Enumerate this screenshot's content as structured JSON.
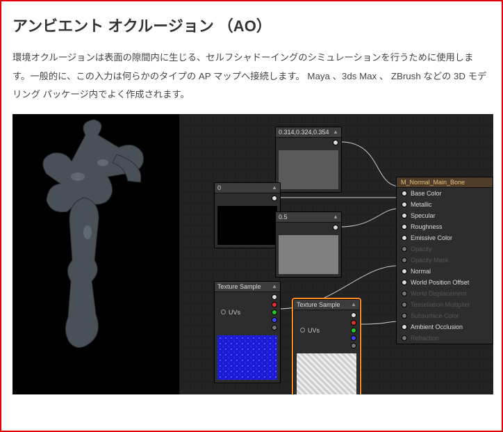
{
  "heading": "アンビエント オクルージョン （AO）",
  "paragraph": "環境オクルージョンは表面の隙間内に生じる、セルフシャドーイングのシミュレーションを行うために使用します。一般的に、この入力は何らかのタイプの AP マップへ接続します。 Maya 、3ds Max 、 ZBrush などの 3D モデリング パッケージ内でよく作成されます。",
  "nodes": {
    "c1": {
      "label": "0.314,0.324,0.354",
      "bg": "#5a5a5a"
    },
    "c2": {
      "label": "0",
      "bg": "#000000"
    },
    "c3": {
      "label": "0.5",
      "bg": "#808080"
    },
    "t1": {
      "label": "Texture Sample",
      "uvs": "UVs",
      "bg": "#1b1bd6"
    },
    "t2": {
      "label": "Texture Sample",
      "uvs": "UVs",
      "bg": "#d8d8d8"
    }
  },
  "material": {
    "title": "M_Normal_Main_Bone",
    "pins": [
      {
        "label": "Base Color",
        "active": true
      },
      {
        "label": "Metallic",
        "active": true
      },
      {
        "label": "Specular",
        "active": true
      },
      {
        "label": "Roughness",
        "active": true
      },
      {
        "label": "Emissive Color",
        "active": true
      },
      {
        "label": "Opacity",
        "active": false
      },
      {
        "label": "Opacity Mask",
        "active": false
      },
      {
        "label": "Normal",
        "active": true
      },
      {
        "label": "World Position Offset",
        "active": true
      },
      {
        "label": "World Displacement",
        "active": false
      },
      {
        "label": "Tessellation Multiplier",
        "active": false
      },
      {
        "label": "Subsurface Color",
        "active": false
      },
      {
        "label": "Ambient Occlusion",
        "active": true
      },
      {
        "label": "Refraction",
        "active": false
      }
    ]
  },
  "tri_up": "▲",
  "tri_dn": "▼"
}
